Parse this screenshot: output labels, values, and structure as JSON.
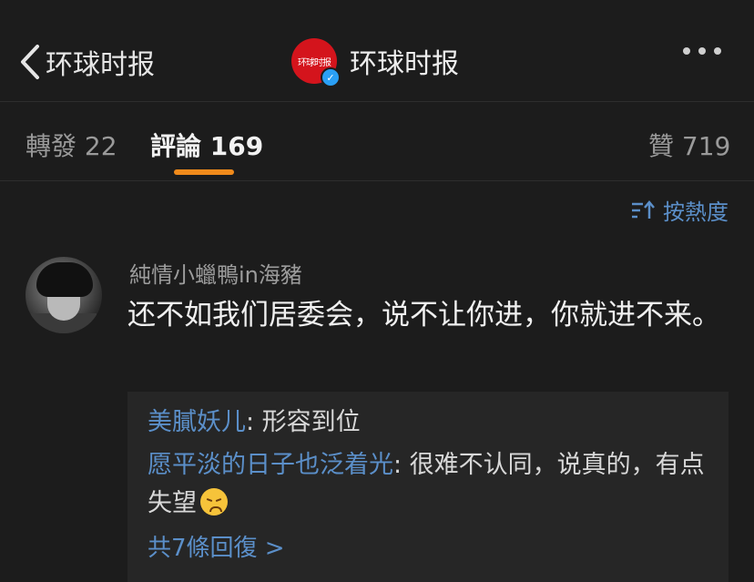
{
  "header": {
    "back_label": "环球时报",
    "title": "环球时报",
    "logo_text": "环球时报"
  },
  "tabs": [
    {
      "label": "轉發",
      "count": "22"
    },
    {
      "label": "評論",
      "count": "169"
    },
    {
      "label": "贊",
      "count": "719"
    }
  ],
  "sort": {
    "label": "按熱度"
  },
  "comment": {
    "user": "純情小蠟鴨in海豬",
    "text": "还不如我们居委会，说不让你进，你就进不来。"
  },
  "replies": [
    {
      "name": "美膩妖儿",
      "text": ": 形容到位"
    },
    {
      "name": "愿平淡的日子也泛着光",
      "text": ": 很难不认同，说真的，有点失望",
      "emoji": "disappointed-face"
    }
  ],
  "more_replies": "共7條回復 >",
  "colors": {
    "background": "#1c1c1c",
    "accent": "#f08a1b",
    "link": "#5b8fc9",
    "logo_red": "#d4141c",
    "verified_blue": "#2a9ff5"
  }
}
